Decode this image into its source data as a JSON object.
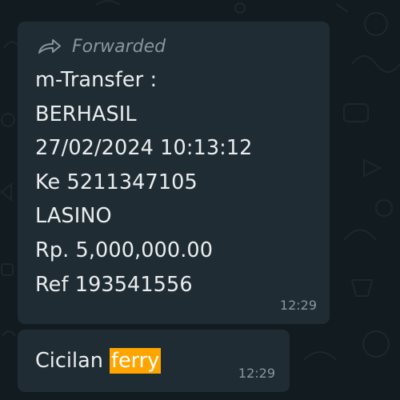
{
  "messages": [
    {
      "forwarded_label": "Forwarded",
      "lines": [
        "m-Transfer :",
        "BERHASIL",
        "27/02/2024 10:13:12",
        "Ke 5211347105",
        "LASINO",
        "Rp. 5,000,000.00",
        "Ref 193541556"
      ],
      "time": "12:29"
    },
    {
      "text_before": "Cicilan ",
      "highlighted": "ferry",
      "time": "12:29"
    }
  ],
  "icons": {
    "forward": "forward-arrow-icon"
  },
  "colors": {
    "bubble": "#202c33",
    "highlight": "#ffa500",
    "meta_text": "#8696a0",
    "text": "#e9edef"
  }
}
